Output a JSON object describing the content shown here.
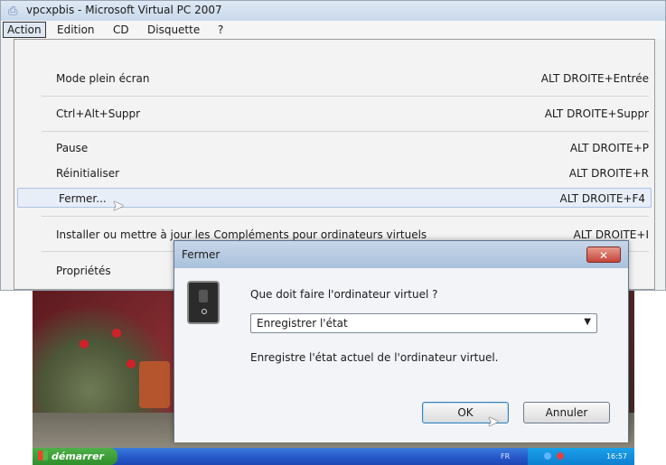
{
  "window": {
    "title": "vpcxpbis - Microsoft Virtual PC 2007"
  },
  "menubar": [
    "Action",
    "Edition",
    "CD",
    "Disquette",
    "?"
  ],
  "action_menu": [
    {
      "label": "Mode plein écran",
      "shortcut": "ALT DROITE+Entrée"
    },
    {
      "label": "Ctrl+Alt+Suppr",
      "shortcut": "ALT DROITE+Suppr"
    },
    {
      "label": "Pause",
      "shortcut": "ALT DROITE+P"
    },
    {
      "label": "Réinitialiser",
      "shortcut": "ALT DROITE+R"
    },
    {
      "label": "Fermer...",
      "shortcut": "ALT DROITE+F4"
    },
    {
      "label": "Installer ou mettre à jour les Compléments pour ordinateurs virtuels",
      "shortcut": "ALT DROITE+I"
    },
    {
      "label": "Propriétés",
      "shortcut": ""
    }
  ],
  "dialog": {
    "title": "Fermer",
    "close_glyph": "✕",
    "question": "Que doit faire l'ordinateur virtuel ?",
    "selected_option": "Enregistrer l'état",
    "description": "Enregistre l'état actuel de l'ordinateur virtuel.",
    "ok_label": "OK",
    "cancel_label": "Annuler"
  },
  "guest": {
    "start_label": "démarrer",
    "tray_lang": "FR",
    "clock": "16:57"
  },
  "colors": {
    "accent": "#3c7fb1",
    "taskbar": "#2456c8",
    "start": "#3f9f3a",
    "close_button": "#c6443a"
  },
  "icons": {
    "app": "virtual-pc-icon",
    "dialog": "power-switch-icon",
    "cursor": "mouse-pointer-icon"
  }
}
